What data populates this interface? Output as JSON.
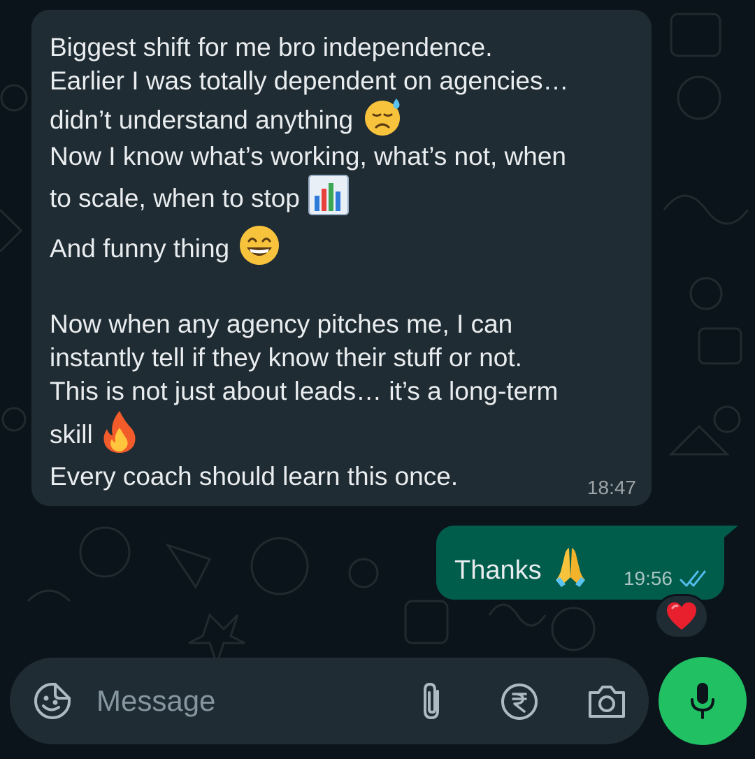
{
  "conversation": {
    "incoming_message": {
      "lines": [
        {
          "text": "Biggest shift for me bro  independence.",
          "emoji": ""
        },
        {
          "text": "Earlier I was totally dependent on agencies…",
          "emoji": ""
        },
        {
          "text": "didn’t understand anything",
          "emoji": "sad-sweat-emoji"
        },
        {
          "text": "Now I know what’s working, what’s not, when",
          "emoji": ""
        },
        {
          "text": "to scale, when to stop",
          "emoji": "bar-chart-emoji"
        },
        {
          "text": "And funny thing",
          "emoji": "grinning-emoji"
        },
        {
          "text": "Now when any agency pitches me, I can",
          "emoji": ""
        },
        {
          "text": "instantly tell if they know their stuff or not.",
          "emoji": ""
        },
        {
          "text": "This is not just about leads… it’s a long-term",
          "emoji": ""
        },
        {
          "text": "skill",
          "emoji": "fire-emoji"
        },
        {
          "text": "Every coach should learn this once.",
          "emoji": ""
        }
      ],
      "time": "18:47"
    },
    "outgoing_message": {
      "text": "Thanks",
      "emoji": "folded-hands-emoji",
      "time": "19:56",
      "status_icon": "double-check-read-icon"
    },
    "reaction": {
      "emoji": "red-heart-emoji"
    }
  },
  "composer": {
    "placeholder": "Message",
    "icons": [
      "sticker-icon",
      "attach-paperclip-icon",
      "rupee-payment-icon",
      "camera-icon",
      "microphone-icon"
    ]
  },
  "colors": {
    "background": "#0b141a",
    "incoming_bubble": "#202c33",
    "outgoing_bubble": "#005c4b",
    "text": "#e9edef",
    "muted": "#8696a0",
    "read_ticks": "#53bdeb",
    "mic_button": "#21c063"
  }
}
